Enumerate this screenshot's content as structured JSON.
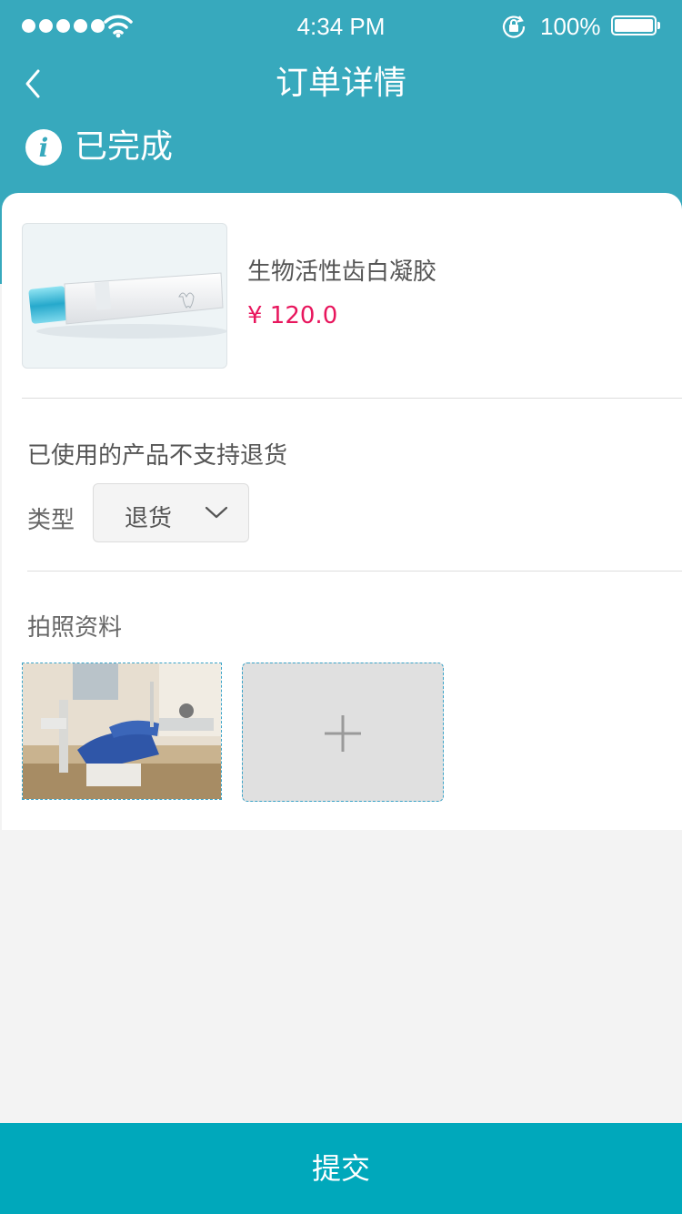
{
  "status_bar": {
    "time": "4:34 PM",
    "battery": "100%"
  },
  "nav": {
    "title": "订单详情"
  },
  "order": {
    "status": "已完成"
  },
  "product": {
    "name": "生物活性齿白凝胶",
    "price": "¥ 120.0"
  },
  "return_form": {
    "notice": "已使用的产品不支持退货",
    "type_label": "类型",
    "type_value": "退货",
    "photo_label": "拍照资料"
  },
  "submit_label": "提交",
  "colors": {
    "header": "#37a9bd",
    "price": "#e8165d",
    "submit": "#00a8bb"
  }
}
